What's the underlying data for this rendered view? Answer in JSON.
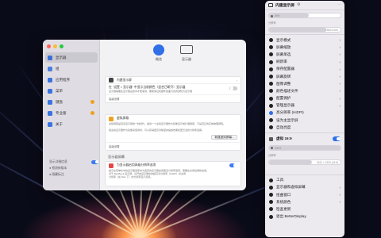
{
  "window": {
    "tabs": [
      {
        "label": "概览"
      },
      {
        "label": "显示器"
      }
    ],
    "sidebar": {
      "items": [
        {
          "label": "显示器"
        },
        {
          "label": "组"
        },
        {
          "label": "应用程序"
        },
        {
          "label": "菜单"
        },
        {
          "label": "键盘"
        },
        {
          "label": "专业版"
        },
        {
          "label": "关于"
        }
      ],
      "footer": {
        "toggle_label": "显示详细信息",
        "line1": "● 检测新版本",
        "line2": "● 隐藏标注"
      }
    },
    "main": {
      "display_row": "内建显示屏",
      "info_row1": "在 \"设置 > 显示器\" 中显示当前颜色（适合已断开）显示器",
      "info_row1_sub": "显示器需要在显示器设置中才能使用，要能保证和硬件层面为您的通知为显示器",
      "info_row2": "高级设置",
      "virtual_title": "虚拟屏幕",
      "virtual_desc": "虚拟屏幕是真实显示屏的一种替代，提供一个虚拟显示器作为镜像显示或扩展屏幕，不是真正的实体物理屏幕。",
      "virtual_desc2": "把虚拟显示器作为镜像来使用时，可以获得更高清晰度的缩放效果和更灵活的分辨率选择。",
      "new_virtual_button": "新建虚拟屏幕...",
      "virtual_advanced": "高级设置",
      "section_label": "显示器屏幕",
      "hires_title": "为显示器启用高级分辨率选项",
      "hires_desc": "提示在菜单栏中的显示器选项中为选定的显示器启用更多分辨率选项，需要在关闭后重新启用。",
      "hires_desc2": "对于 MacBook 显示屏，请开启显示器中的超高清分辨率（HiDPI）并关闭",
      "hires_desc3": "分辨率（如 Mac 下）的分辨率显示选项。"
    }
  },
  "menu": {
    "title": "内建显示屏",
    "brightness": "65%",
    "contrast_label": "分辨率",
    "contrast_value": "1920×1200",
    "items_main": [
      {
        "label": "显示模式",
        "chev": true
      },
      {
        "label": "屏幕缩放",
        "chev": true
      },
      {
        "label": "屏幕单选",
        "chev": true
      },
      {
        "label": "刷新率",
        "chev": true
      },
      {
        "label": "保存配置器",
        "chev": true
      },
      {
        "label": "屏幕旋转",
        "chev": true
      },
      {
        "label": "图像调整",
        "chev": true
      },
      {
        "label": "颜色描述文件",
        "chev": true
      },
      {
        "label": "配置保护",
        "chev": true
      },
      {
        "label": "管理显示器",
        "chev": true
      },
      {
        "label": "高分辨率 (HiDPI)",
        "chev": false
      },
      {
        "label": "设为主显示屏",
        "chev": false
      },
      {
        "label": "自动亮度",
        "chev": false
      }
    ],
    "virtual_title": "虚拟 16:9",
    "virtual_slider": "100%",
    "virtual_res_label": "分辨率",
    "virtual_res_value": "3412 × 1920 (16:9)",
    "items_tools": [
      {
        "label": "工具",
        "chev": false
      },
      {
        "label": "显示器和虚拟屏幕",
        "chev": true
      },
      {
        "label": "扭曲窗口",
        "chev": true
      },
      {
        "label": "系统颜色",
        "chev": true
      },
      {
        "label": "检查更新",
        "chev": false
      },
      {
        "label": "退出 BetterDisplay",
        "chev": false
      }
    ]
  }
}
